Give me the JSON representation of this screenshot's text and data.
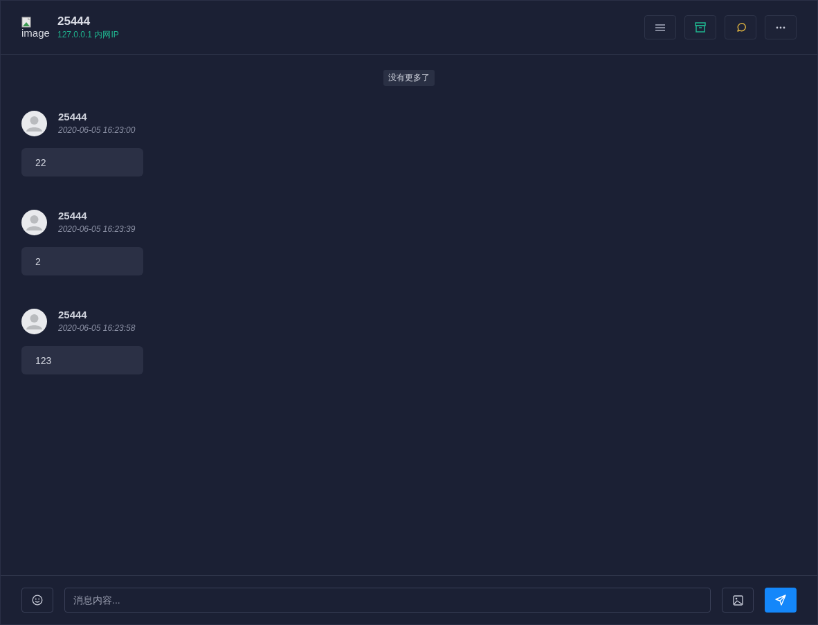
{
  "header": {
    "avatar_alt": "image",
    "title": "25444",
    "subtitle": "127.0.0.1 内网IP"
  },
  "notice": "没有更多了",
  "messages": [
    {
      "author": "25444",
      "time": "2020-06-05 16:23:00",
      "text": "22"
    },
    {
      "author": "25444",
      "time": "2020-06-05 16:23:39",
      "text": "2"
    },
    {
      "author": "25444",
      "time": "2020-06-05 16:23:58",
      "text": "123"
    }
  ],
  "composer": {
    "placeholder": "消息内容..."
  }
}
